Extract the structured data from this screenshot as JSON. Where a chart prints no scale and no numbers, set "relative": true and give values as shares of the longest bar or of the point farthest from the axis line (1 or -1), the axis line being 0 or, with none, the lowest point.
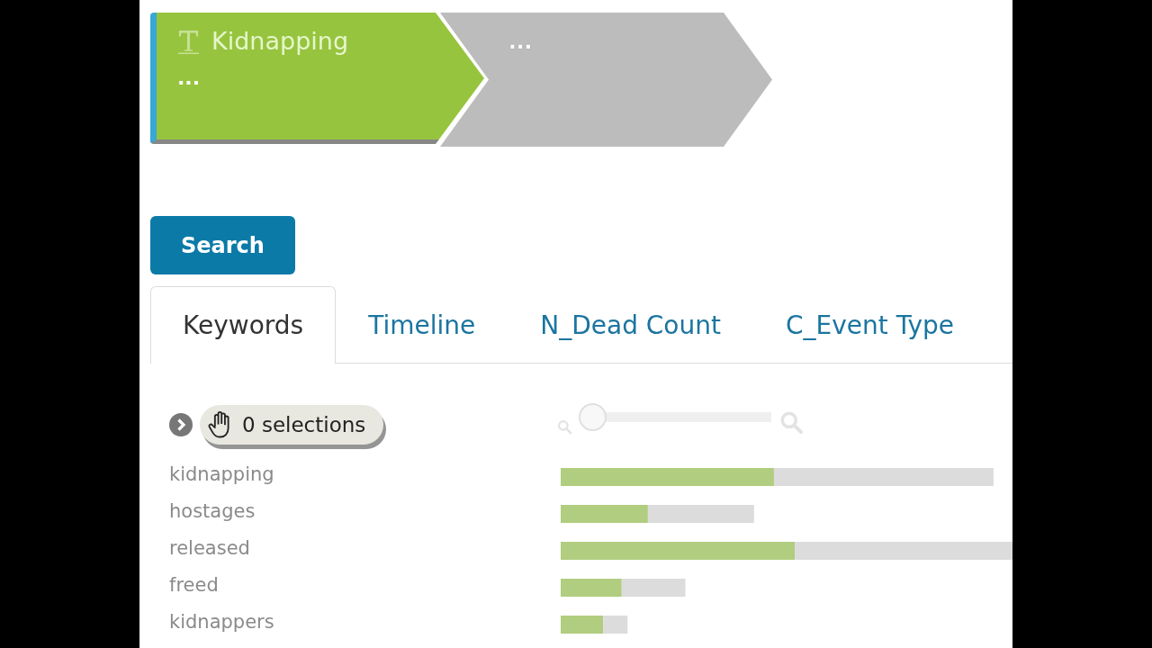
{
  "steps": [
    {
      "kind": "text",
      "title": "Kidnapping",
      "subtitle": "...",
      "selected": true
    },
    {
      "kind": "empty",
      "title": "...",
      "selected": false
    }
  ],
  "search_button": {
    "label": "Search"
  },
  "tabs": [
    {
      "label": "Keywords",
      "selected": true
    },
    {
      "label": "Timeline",
      "selected": false
    },
    {
      "label": "N_Dead Count",
      "selected": false
    },
    {
      "label": "C_Event Type",
      "selected": false
    }
  ],
  "selections": {
    "label": "0 selections",
    "expanded": false
  },
  "zoom_slider": {
    "level": 0.07,
    "disabled": true
  },
  "keywords": {
    "chart_data": {
      "type": "bar",
      "orientation": "horizontal",
      "stacked": true,
      "relative": true,
      "categories": [
        "kidnapping",
        "hostages",
        "released",
        "freed",
        "kidnappers"
      ],
      "series": [
        {
          "color": "#b1cd7f",
          "values": [
            0.472,
            0.193,
            0.518,
            0.135,
            0.094
          ]
        },
        {
          "color": "#dcdcdc",
          "values": [
            0.486,
            0.235,
            0.482,
            0.141,
            0.054
          ]
        }
      ]
    }
  }
}
